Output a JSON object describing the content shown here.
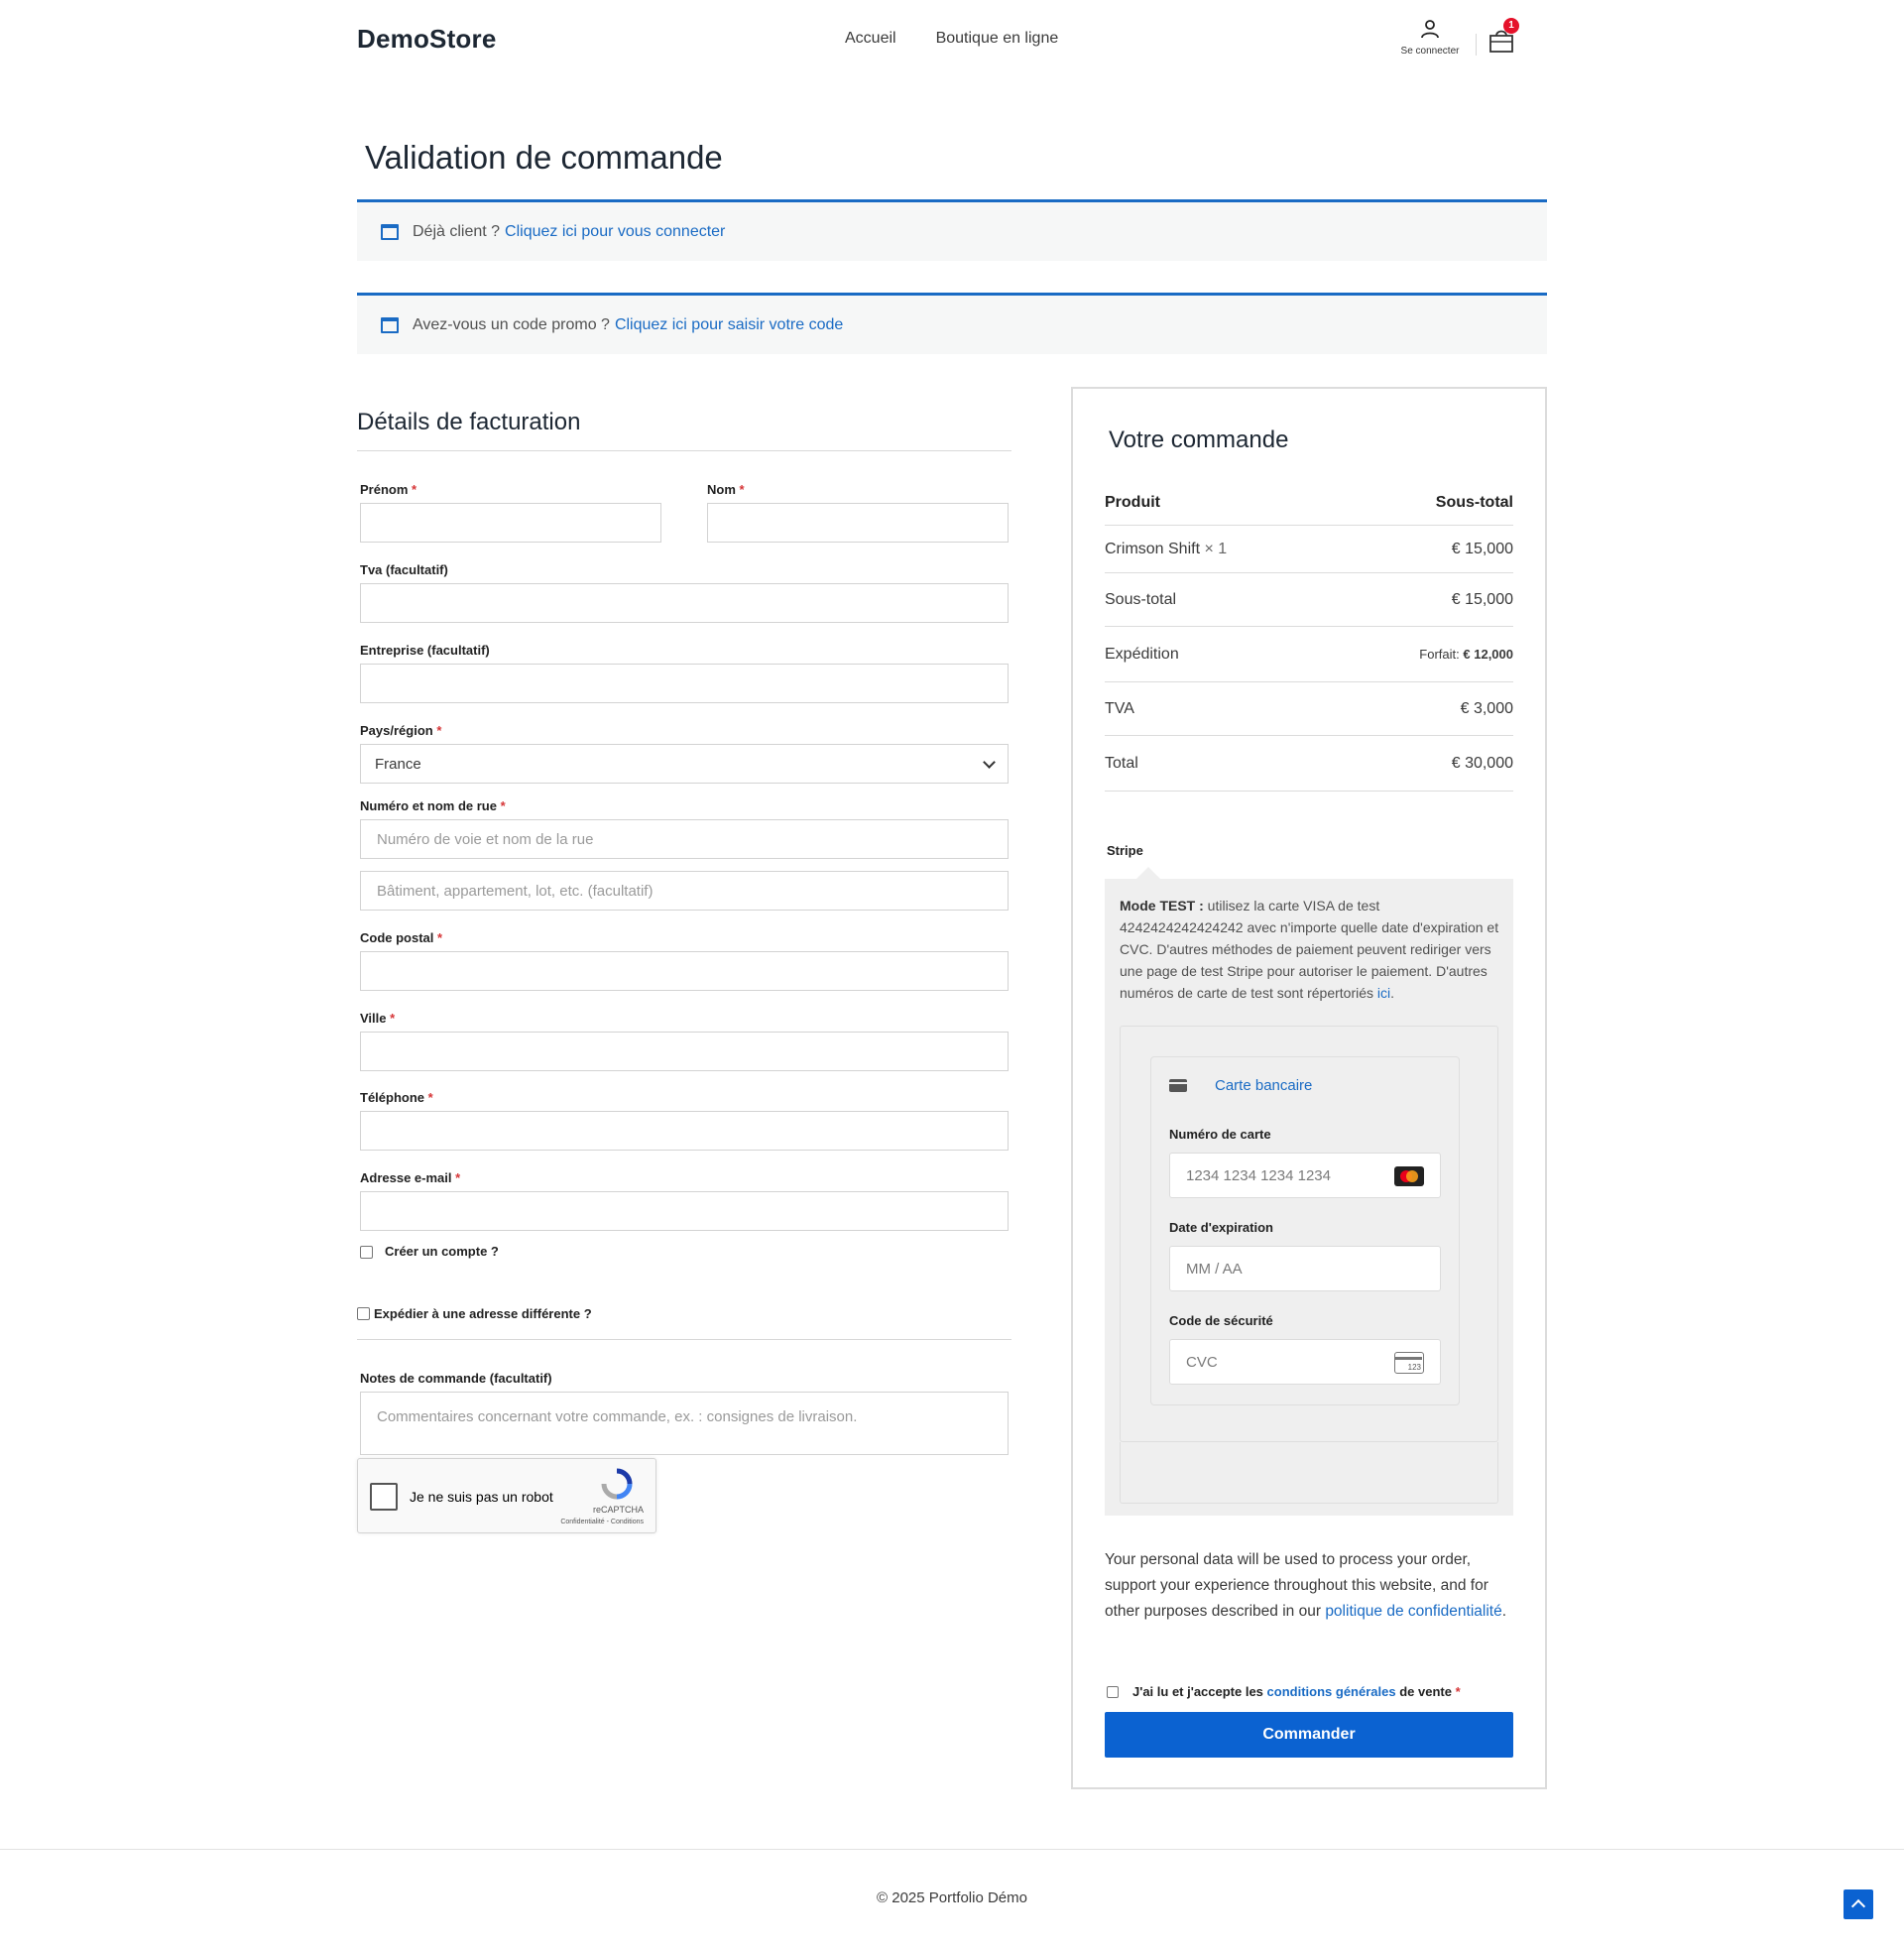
{
  "header": {
    "logo": "DemoStore",
    "nav": [
      "Accueil",
      "Boutique en ligne"
    ],
    "account_label": "Se connecter",
    "cart_count": "1"
  },
  "page_title": "Validation de commande",
  "notices": {
    "login_text": "Déjà client ?",
    "login_link": "Cliquez ici pour vous connecter",
    "coupon_text": "Avez-vous un code promo ?",
    "coupon_link": "Cliquez ici pour saisir votre code"
  },
  "billing": {
    "title": "Détails de facturation",
    "first_name": "Prénom",
    "last_name": "Nom",
    "vat": "Tva (facultatif)",
    "company": "Entreprise (facultatif)",
    "country": "Pays/région",
    "country_value": "France",
    "street": "Numéro et nom de rue",
    "street_placeholder": "Numéro de voie et nom de la rue",
    "street2_placeholder": "Bâtiment, appartement, lot, etc. (facultatif)",
    "postcode": "Code postal",
    "city": "Ville",
    "phone": "Téléphone",
    "email": "Adresse e-mail",
    "required_mark": "*",
    "create_account": "Créer un compte ?",
    "ship_different": "Expédier à une adresse différente ?",
    "notes_label": "Notes de commande (facultatif)",
    "notes_placeholder": "Commentaires concernant votre commande, ex. : consignes de livraison."
  },
  "recaptcha": {
    "label": "Je ne suis pas un robot",
    "brand": "reCAPTCHA",
    "terms": "Confidentialité - Conditions"
  },
  "order": {
    "title": "Votre commande",
    "col_product": "Produit",
    "col_subtotal": "Sous-total",
    "item_name": "Crimson Shift",
    "item_qty": "× 1",
    "item_total": "€ 15,000",
    "subtotal_label": "Sous-total",
    "subtotal_value": "€ 15,000",
    "shipping_label": "Expédition",
    "shipping_prefix": "Forfait:",
    "shipping_value": "€ 12,000",
    "tax_label": "TVA",
    "tax_value": "€ 3,000",
    "total_label": "Total",
    "total_value": "€ 30,000",
    "payment_method": "Stripe",
    "test_mode_bold": "Mode TEST :",
    "test_mode_text": "utilisez la carte VISA de test 4242424242424242 avec n'importe quelle date d'expiration et CVC. D'autres méthodes de paiement peuvent rediriger vers une page de test Stripe pour autoriser le paiement. D'autres numéros de carte de test sont répertoriés",
    "test_mode_link": "ici",
    "card_tab": "Carte bancaire",
    "card_number_label": "Numéro de carte",
    "card_number_placeholder": "1234 1234 1234 1234",
    "expiry_label": "Date d'expiration",
    "expiry_placeholder": "MM / AA",
    "cvc_label": "Code de sécurité",
    "cvc_placeholder": "CVC",
    "cvc_icon_text": "123",
    "privacy_text": "Your personal data will be used to process your order, support your experience throughout this website, and for other purposes described in our",
    "privacy_link": "politique de confidentialité",
    "terms_prefix": "J'ai lu et j'accepte les",
    "terms_link": "conditions générales",
    "terms_suffix": "de vente",
    "place_order": "Commander"
  },
  "footer": {
    "copyright": "© 2025 Portfolio Démo"
  },
  "colors": {
    "accent": "#1a6bc4",
    "button": "#0b62d1",
    "required": "#d63638",
    "badge": "#e5112a"
  }
}
